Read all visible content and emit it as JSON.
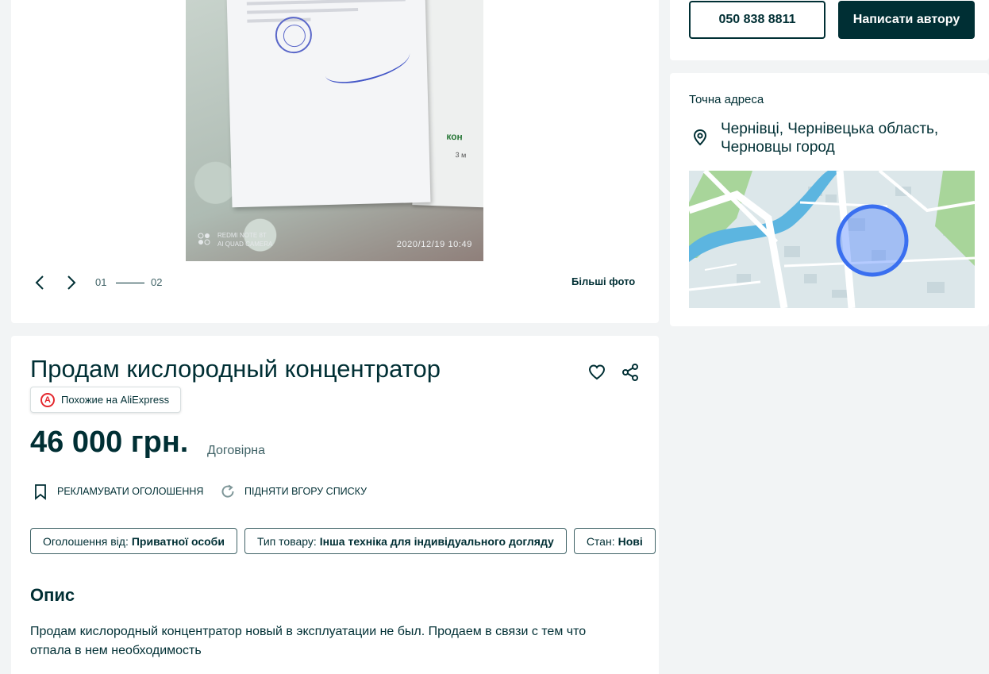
{
  "gallery": {
    "photo_watermark_device": "REDMI NOTE 8T",
    "photo_watermark_camera": "AI QUAD CAMERA",
    "photo_watermark_date": "2020/12/19   10:49",
    "counter_current": "01",
    "counter_total": "02",
    "more_photos_label": "Більші фото"
  },
  "contact": {
    "phone_label": "050 838 8811",
    "write_label": "Написати автору"
  },
  "address": {
    "label": "Точна адреса",
    "text": "Чернівці, Чернівецька область, Черновцы город"
  },
  "ad": {
    "title": "Продам кислородный концентратор",
    "ali_badge_label": "Похожие на AliExpress",
    "price": "46 000 грн.",
    "negotiable": "Договірна",
    "promote_label": "Рекламувати оголошення",
    "lift_label": "Підняти вгору списку",
    "tags": [
      {
        "key": "Оголошення від:",
        "value": "Приватної особи"
      },
      {
        "key": "Тип товару:",
        "value": "Інша техніка для індивідуального догляду"
      },
      {
        "key": "Стан:",
        "value": "Нові"
      }
    ],
    "description_title": "Опис",
    "description": "Продам кислородный концентратор новый в эксплуатации не был. Продаем в связи с тем что отпала в нем необходимость"
  },
  "colors": {
    "brand_dark": "#002f34",
    "page_bg": "#f2f4f5",
    "map_circle": "#3a6ff0"
  }
}
